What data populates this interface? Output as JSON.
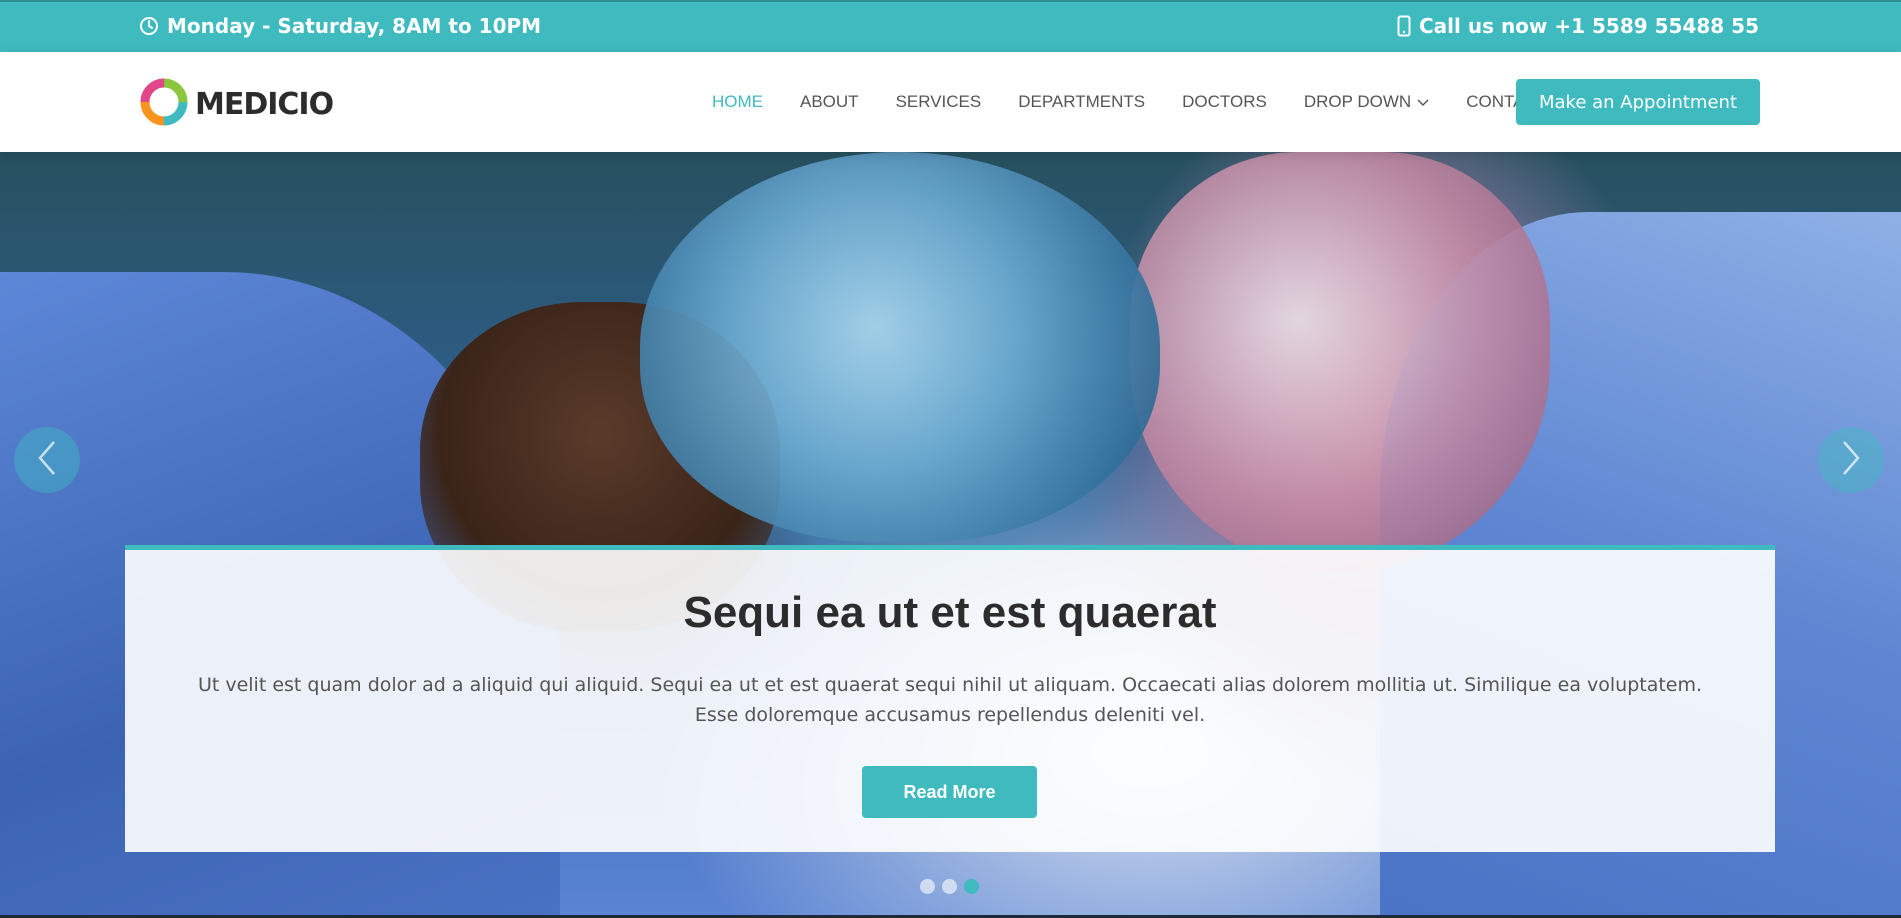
{
  "topbar": {
    "hours": "Monday - Saturday, 8AM to 10PM",
    "phone": "Call us now +1 5589 55488 55",
    "hours_icon": "clock-icon",
    "phone_icon": "phone-icon"
  },
  "header": {
    "brand": "MEDICIO",
    "nav": [
      {
        "label": "HOME",
        "active": true
      },
      {
        "label": "ABOUT"
      },
      {
        "label": "SERVICES"
      },
      {
        "label": "DEPARTMENTS"
      },
      {
        "label": "DOCTORS"
      },
      {
        "label": "DROP DOWN"
      },
      {
        "label": "CONTACT"
      }
    ],
    "cta": "Make an Appointment"
  },
  "hero": {
    "title": "Sequi ea ut et est quaerat",
    "text": "Ut velit est quam dolor ad a aliquid qui aliquid. Sequi ea ut et est quaerat sequi nihil ut aliquam. Occaecati alias dolorem mollitia ut. Similique ea voluptatem. Esse doloremque accusamus repellendus deleniti vel.",
    "button": "Read More",
    "slide_count": 3,
    "active_slide": 3
  },
  "colors": {
    "accent": "#3fbbc0",
    "text_dark": "#2c2c2c",
    "text_muted": "#555555"
  }
}
